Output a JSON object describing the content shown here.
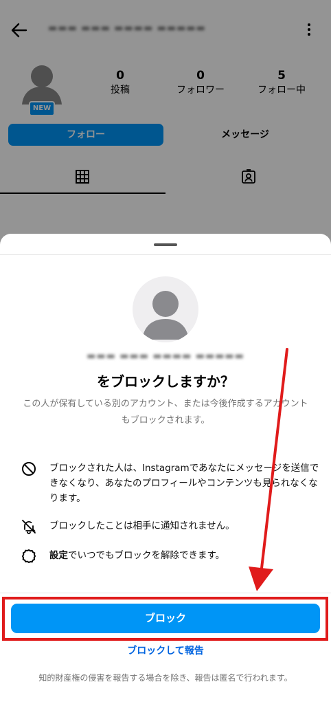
{
  "header": {
    "username_blurred": "▬▬▬ ▬▬▬ ▬▬▬▬ ▬▬▬▬▬"
  },
  "profile": {
    "avatar_badge": "NEW",
    "stats": [
      {
        "num": "0",
        "label": "投稿"
      },
      {
        "num": "0",
        "label": "フォロワー"
      },
      {
        "num": "5",
        "label": "フォロー中"
      }
    ],
    "follow_label": "フォロー",
    "message_label": "メッセージ"
  },
  "sheet": {
    "username_blurred": "▬▬▬ ▬▬▬ ▬▬▬▬ ▬▬▬▬▬",
    "title": "をブロックしますか？",
    "subtitle": "この人が保有している別のアカウント、または今後作成するアカウントもブロックされます。",
    "items": [
      {
        "text": "ブロックされた人は、Instagramであなたにメッセージを送信できなくなり、あなたのプロフィールやコンテンツも見られなくなります。"
      },
      {
        "text": "ブロックしたことは相手に通知されません。"
      },
      {
        "bold": "設定",
        "text": "でいつでもブロックを解除できます。"
      }
    ],
    "block_button": "ブロック",
    "block_report_link": "ブロックして報告",
    "footer": "知的財産権の侵害を報告する場合を除き、報告は匿名で行われます。"
  },
  "colors": {
    "primary": "#0095F6",
    "link": "#0064E0",
    "annotation_red": "#E01B1B"
  }
}
